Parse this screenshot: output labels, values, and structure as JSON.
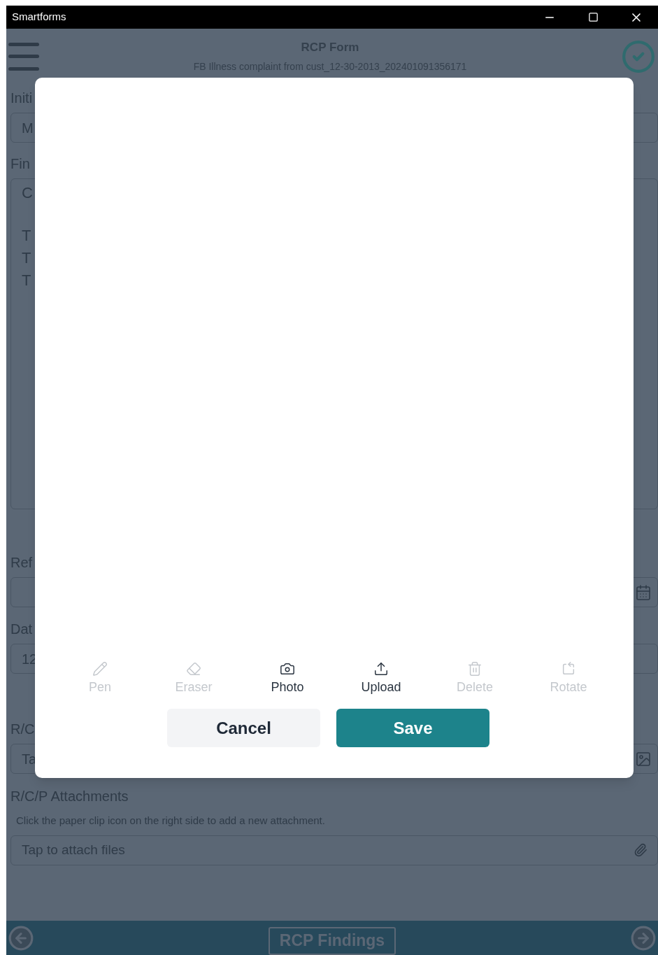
{
  "window": {
    "title": "Smartforms"
  },
  "header": {
    "title": "RCP Form",
    "subtitle": "FB Illness complaint from cust_12-30-2013_202401091356171",
    "done": true
  },
  "form": {
    "fields": [
      {
        "kind": "text",
        "label": "Initi",
        "value": "M"
      },
      {
        "kind": "textarea",
        "label": "Fin",
        "lines": [
          "C",
          "T",
          "T",
          "T"
        ]
      },
      {
        "kind": "date",
        "label": "Ref"
      },
      {
        "kind": "text",
        "label": "Dat",
        "value": "12"
      },
      {
        "kind": "image",
        "label": "R/C",
        "value": "Ta"
      }
    ],
    "attachments": {
      "label": "R/C/P Attachments",
      "hint": "Click the paper clip icon on the right side to add a new attachment.",
      "placeholder": "Tap to attach files"
    }
  },
  "footer": {
    "section": "RCP Findings"
  },
  "dialog": {
    "tools": [
      {
        "kind": "pen",
        "label": "Pen",
        "disabled": true
      },
      {
        "kind": "eraser",
        "label": "Eraser",
        "disabled": true
      },
      {
        "kind": "photo",
        "label": "Photo",
        "disabled": false
      },
      {
        "kind": "upload",
        "label": "Upload",
        "disabled": false
      },
      {
        "kind": "delete",
        "label": "Delete",
        "disabled": true
      },
      {
        "kind": "rotate",
        "label": "Rotate",
        "disabled": true
      }
    ],
    "buttons": [
      {
        "kind": "secondary",
        "label": "Cancel"
      },
      {
        "kind": "primary",
        "label": "Save"
      }
    ]
  }
}
